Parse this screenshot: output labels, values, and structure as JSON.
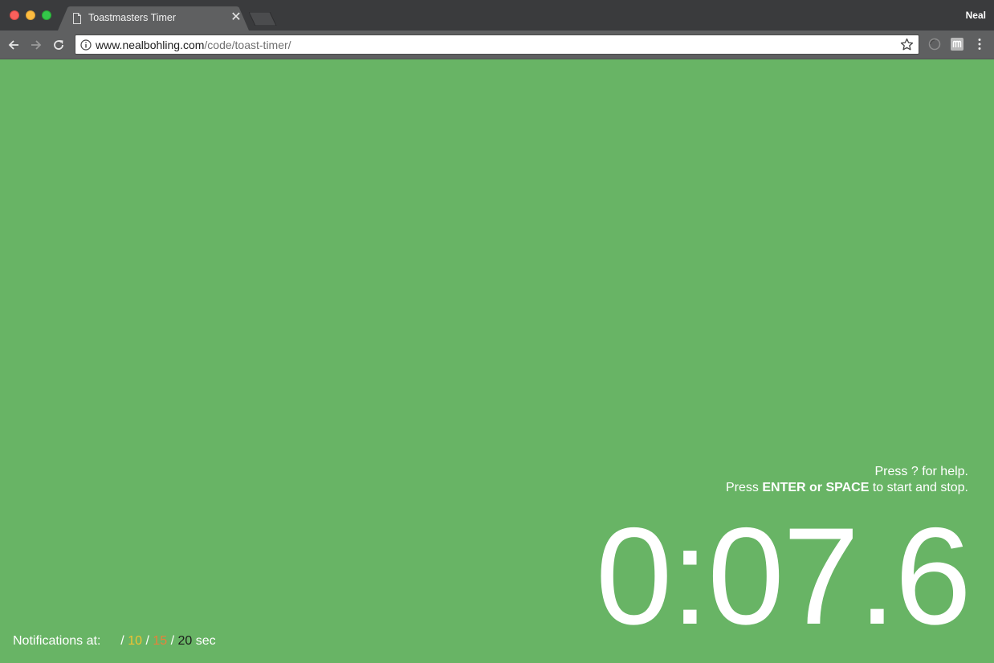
{
  "window": {
    "profile_name": "Neal"
  },
  "tab": {
    "title": "Toastmasters Timer",
    "close_glyph": "✕",
    "icon": "document-icon"
  },
  "omnibox": {
    "url_host": "www.nealbohling.com",
    "url_path": "/code/toast-timer/"
  },
  "help": {
    "line1": "Press ? for help.",
    "line2_prefix": "Press ",
    "line2_keys_1": "ENTER",
    "line2_or": " or ",
    "line2_keys_2": "SPACE",
    "line2_suffix": " to start and stop."
  },
  "timer": {
    "display": "0:07.6"
  },
  "notifications": {
    "label": "Notifications at:",
    "separator": "/",
    "green_value": "",
    "yellow_value": "10",
    "red_value": "15",
    "end_value": "20",
    "unit": "sec"
  },
  "colors": {
    "background": "#68b465",
    "yellow": "#f2c231",
    "orange": "#e9803a",
    "dark": "#1c1c1c"
  }
}
